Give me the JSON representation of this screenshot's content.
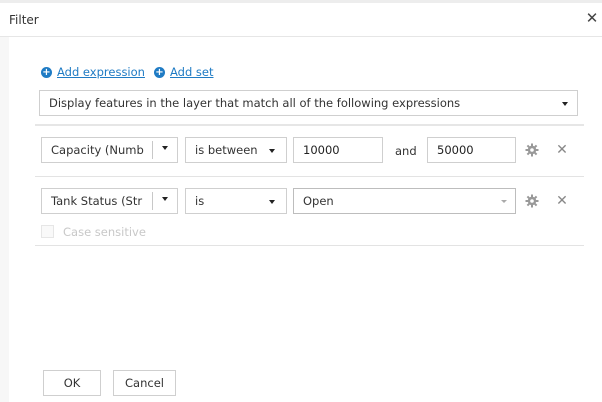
{
  "dialog": {
    "title": "Filter"
  },
  "add": {
    "expression_label": "Add expression",
    "set_label": "Add set"
  },
  "match_mode": {
    "selected": "Display features in the layer that match all of the following expressions"
  },
  "expressions": [
    {
      "field": "Capacity (Numb",
      "operator": "is between",
      "value_from": "10000",
      "conjunction": "and",
      "value_to": "50000"
    },
    {
      "field": "Tank Status (Str",
      "operator": "is",
      "value": "Open",
      "case_sensitive_label": "Case sensitive",
      "case_sensitive_checked": false
    }
  ],
  "footer": {
    "ok_label": "OK",
    "cancel_label": "Cancel"
  }
}
